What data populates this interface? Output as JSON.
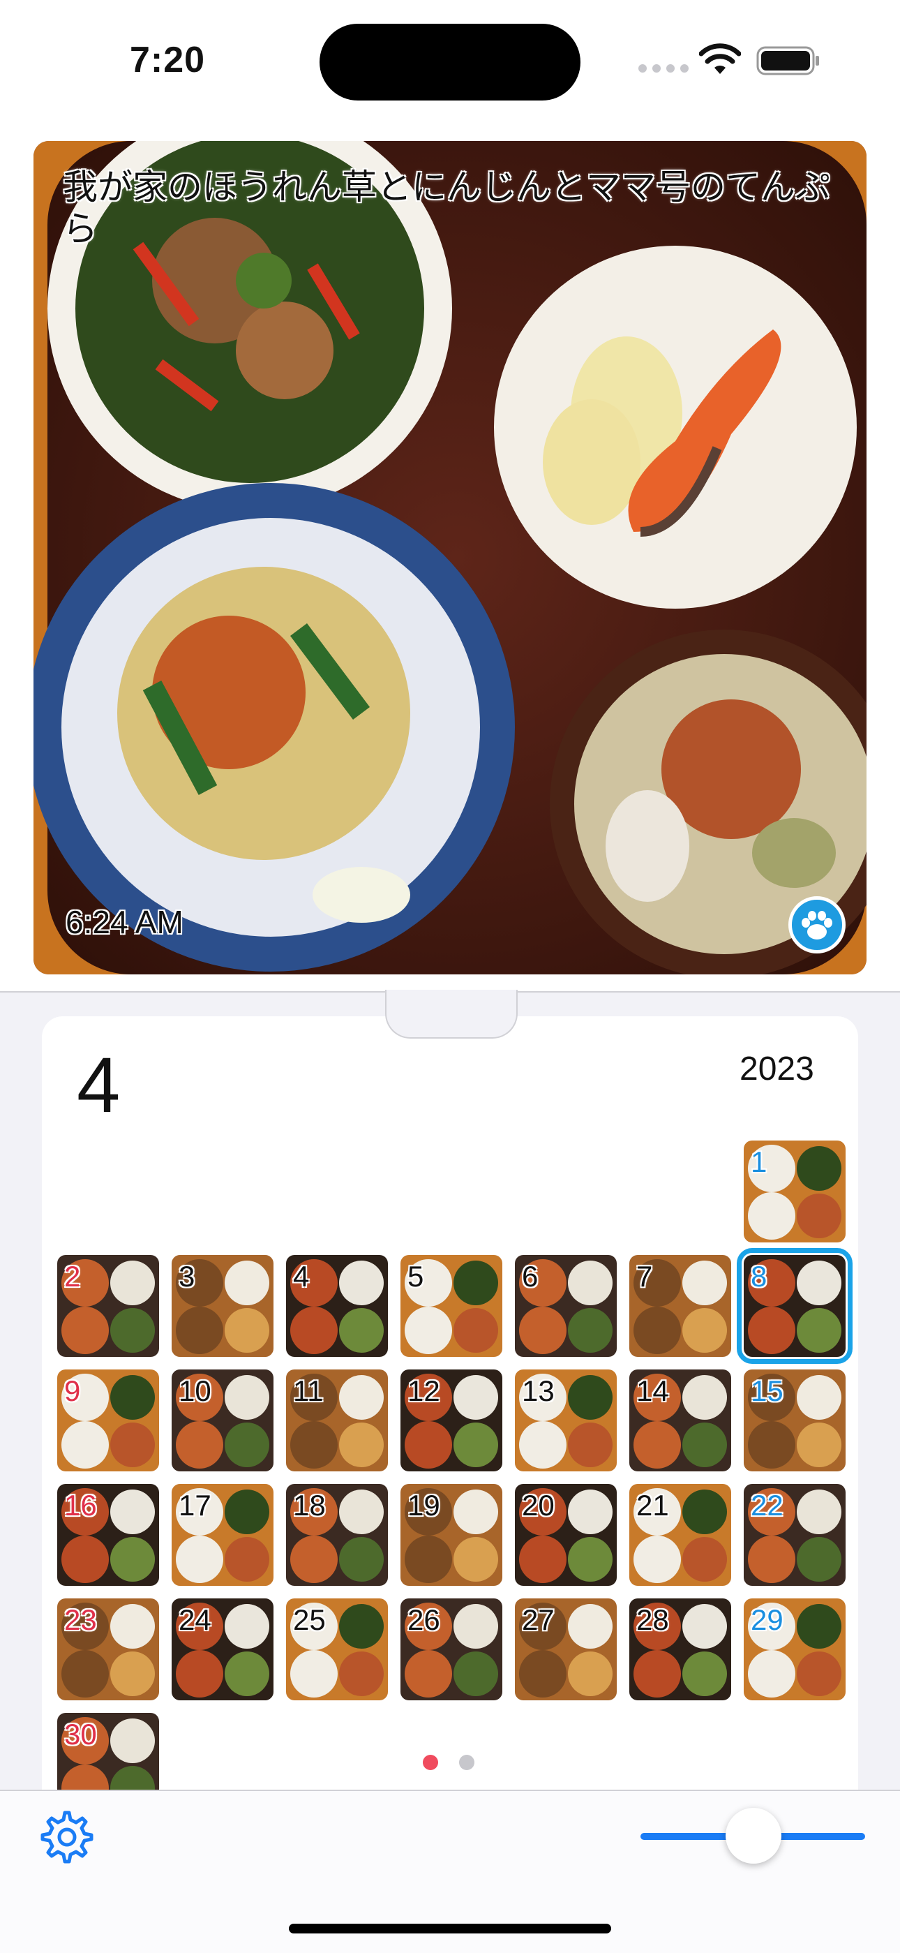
{
  "status_bar": {
    "time": "7:20"
  },
  "photo": {
    "title": "我が家のほうれん草とにんじんとママ号のてんぷら",
    "time": "6:24 AM",
    "paw_icon": "paw-icon"
  },
  "calendar": {
    "month": "4",
    "year": "2023",
    "selected_day": "8",
    "days": [
      {
        "label": "1",
        "color": "#1a8fe0"
      },
      {
        "label": "2",
        "color": "#e0304a"
      },
      {
        "label": "3",
        "color": "#111111"
      },
      {
        "label": "4",
        "color": "#111111"
      },
      {
        "label": "5",
        "color": "#111111"
      },
      {
        "label": "6",
        "color": "#111111"
      },
      {
        "label": "7",
        "color": "#111111"
      },
      {
        "label": "8",
        "color": "#1a8fe0"
      },
      {
        "label": "9",
        "color": "#e0304a"
      },
      {
        "label": "10",
        "color": "#111111"
      },
      {
        "label": "11",
        "color": "#111111"
      },
      {
        "label": "12",
        "color": "#111111"
      },
      {
        "label": "13",
        "color": "#111111"
      },
      {
        "label": "14",
        "color": "#111111"
      },
      {
        "label": "15",
        "color": "#1a8fe0"
      },
      {
        "label": "16",
        "color": "#e0304a"
      },
      {
        "label": "17",
        "color": "#111111"
      },
      {
        "label": "18",
        "color": "#111111"
      },
      {
        "label": "19",
        "color": "#111111"
      },
      {
        "label": "20",
        "color": "#111111"
      },
      {
        "label": "21",
        "color": "#111111"
      },
      {
        "label": "22",
        "color": "#1a8fe0"
      },
      {
        "label": "23",
        "color": "#e0304a"
      },
      {
        "label": "24",
        "color": "#111111"
      },
      {
        "label": "25",
        "color": "#111111"
      },
      {
        "label": "26",
        "color": "#111111"
      },
      {
        "label": "27",
        "color": "#111111"
      },
      {
        "label": "28",
        "color": "#111111"
      },
      {
        "label": "29",
        "color": "#1a8fe0"
      },
      {
        "label": "30",
        "color": "#e0304a"
      }
    ],
    "page_dots": {
      "active_color": "#f04b5e",
      "inactive_color": "#c7c7cc"
    }
  },
  "toolbar": {
    "settings_icon": "gear-icon",
    "accent": "#1a7cf5"
  }
}
